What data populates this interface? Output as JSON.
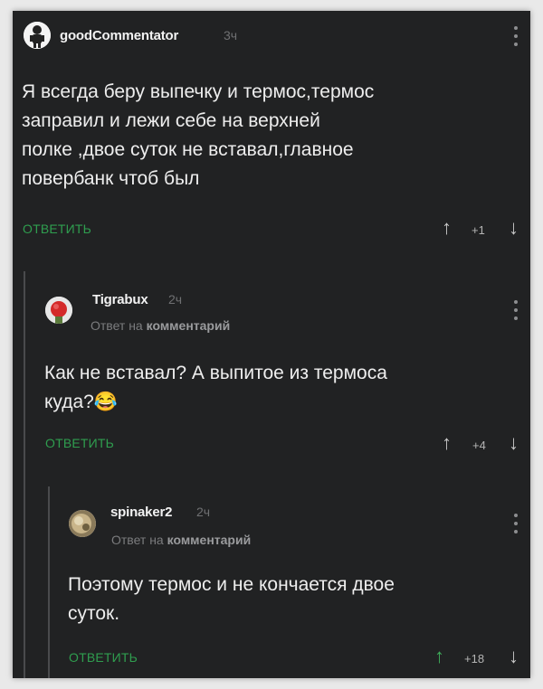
{
  "comments": [
    {
      "author": "goodCommentator",
      "time": "3ч",
      "text": "Я всегда беру выпечку и термос,термос\nзаправил и лежи себе на верхней\nполке ,двое суток не вставал,главное\nповербанк чтоб был",
      "reply_label": "ОТВЕТИТЬ",
      "score": "+1"
    },
    {
      "author": "Tigrabux",
      "time": "2ч",
      "reply_prefix": "Ответ на",
      "reply_target": "комментарий",
      "text": "Как не вставал? А выпитое из термоса\nкуда?😂",
      "reply_label": "ОТВЕТИТЬ",
      "score": "+4"
    },
    {
      "author": "spinaker2",
      "time": "2ч",
      "reply_prefix": "Ответ на",
      "reply_target": "комментарий",
      "text": "Поэтому термос и не кончается двое\nсуток.",
      "reply_label": "ОТВЕТИТЬ",
      "score": "+18"
    }
  ],
  "icons": {
    "vote_up": "↑",
    "vote_down": "↓"
  },
  "colors": {
    "background": "#212223",
    "accent_green": "#2f9e4f",
    "text": "#eeeeee"
  }
}
